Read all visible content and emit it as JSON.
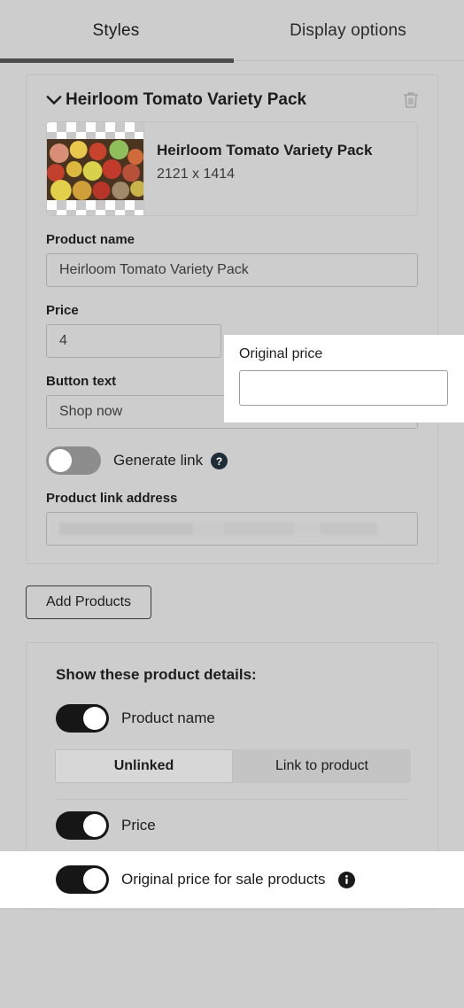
{
  "tabs": [
    {
      "label": "Styles",
      "active": true
    },
    {
      "label": "Display options",
      "active": false
    }
  ],
  "product_card": {
    "title": "Heirloom Tomato Variety Pack",
    "collapse_icon": "chevron-down-icon",
    "delete_icon": "trash-icon",
    "thumbnail": {
      "name": "Heirloom Tomato Variety Pack",
      "dimensions": "2121 x 1414"
    },
    "fields": {
      "product_name_label": "Product name",
      "product_name_value": "Heirloom Tomato Variety Pack",
      "price_label": "Price",
      "price_value": "4",
      "button_text_label": "Button text",
      "button_text_value": "Shop now",
      "product_link_label": "Product link address",
      "product_link_value": ""
    },
    "generate_link": {
      "label": "Generate link",
      "state": "off",
      "help_icon": "question-mark-icon"
    }
  },
  "original_price_overlay": {
    "label": "Original price",
    "value": "",
    "placeholder": ""
  },
  "add_products_button": "Add Products",
  "details": {
    "title": "Show these product details:",
    "rows": [
      {
        "label": "Product name",
        "state": "on",
        "info": false
      },
      {
        "label": "Price",
        "state": "on",
        "info": false
      },
      {
        "label": "Original price for sale products",
        "state": "on",
        "info": true,
        "info_icon": "info-icon"
      }
    ],
    "link_segment": {
      "options": [
        "Unlinked",
        "Link to product"
      ],
      "selected": "Unlinked"
    }
  },
  "colors": {
    "background": "#cdcdcd",
    "accent_dark": "#4d4d4d",
    "toggle_on": "#161616",
    "toggle_off": "#8d8d8d",
    "overlay_bg": "#ffffff"
  }
}
